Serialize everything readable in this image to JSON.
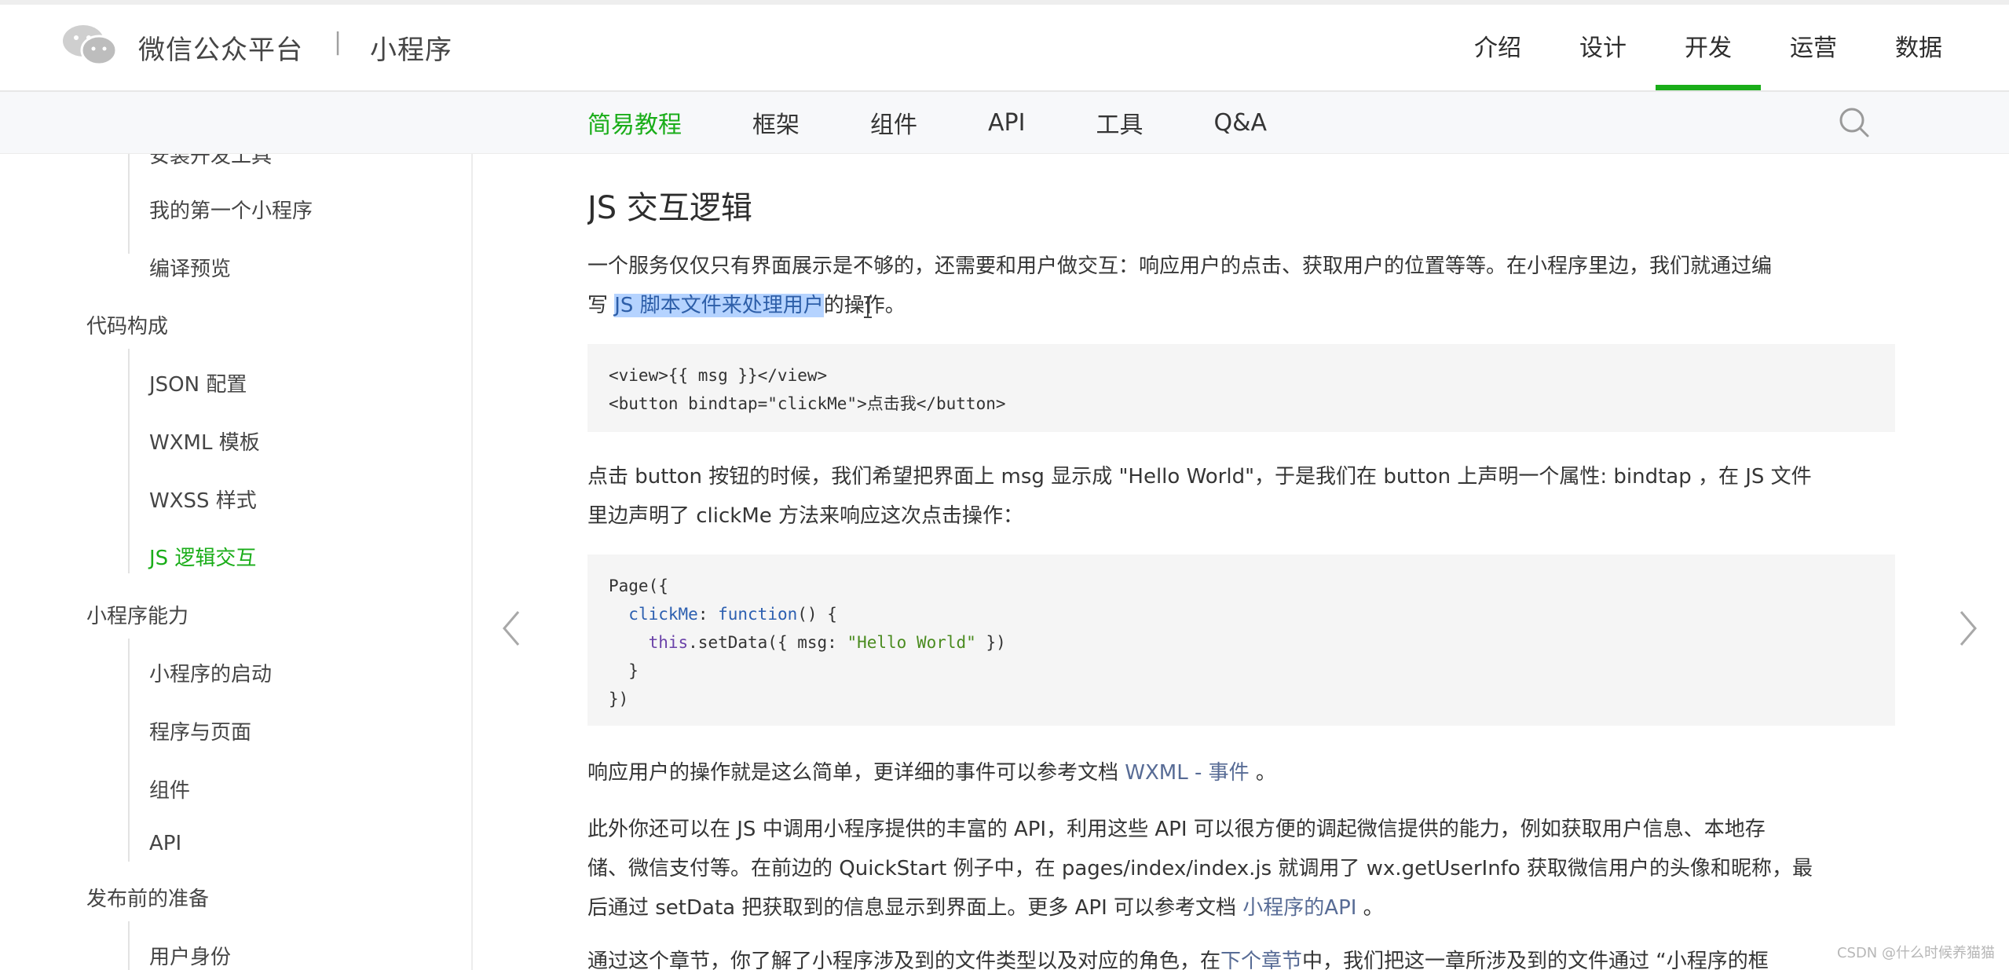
{
  "header": {
    "brand": "微信公众平台",
    "separator": "|",
    "sub_brand": "小程序",
    "nav": [
      {
        "label": "介绍"
      },
      {
        "label": "设计"
      },
      {
        "label": "开发",
        "active": true
      },
      {
        "label": "运营"
      },
      {
        "label": "数据"
      }
    ]
  },
  "subnav": {
    "items": [
      {
        "label": "简易教程",
        "active": true
      },
      {
        "label": "框架"
      },
      {
        "label": "组件"
      },
      {
        "label": "API"
      },
      {
        "label": "工具"
      },
      {
        "label": "Q&A"
      }
    ],
    "search_icon": "search-icon"
  },
  "sidebar": {
    "partial_top": "安装开发工具",
    "items": [
      {
        "label": "我的第一个小程序"
      },
      {
        "label": "编译预览"
      }
    ],
    "groups": [
      {
        "label": "代码构成",
        "items": [
          "JSON 配置",
          "WXML 模板",
          "WXSS 样式",
          "JS 逻辑交互"
        ]
      },
      {
        "label": "小程序能力",
        "items": [
          "小程序的启动",
          "程序与页面",
          "组件",
          "API"
        ]
      },
      {
        "label": "发布前的准备",
        "items": [
          "用户身份"
        ]
      }
    ],
    "active_item": "JS 逻辑交互"
  },
  "content": {
    "title": "JS 交互逻辑",
    "p1_a": "一个服务仅仅只有界面展示是不够的，还需要和用户做交互：响应用户的点击、获取用户的位置等等。在小程序里边，我们就通过编",
    "p1_b_pre": "写 ",
    "p1_b_hl": "JS 脚本文件来处理用户",
    "p1_b_post": "的操作。",
    "code1_line1": "<view>{{ msg }}</view>",
    "code1_line2": "<button bindtap=\"clickMe\">点击我</button>",
    "p2_a": "点击 button 按钮的时候，我们希望把界面上 msg 显示成 \"Hello World\"，于是我们在 button 上声明一个属性: bindtap ，在 JS 文件",
    "p2_b": "里边声明了 clickMe 方法来响应这次点击操作：",
    "code2": {
      "l1": "Page({",
      "l2_prop": "clickMe",
      "l2_colon": ": ",
      "l2_fn": "function",
      "l2_rest": "() {",
      "l3_this": "this",
      "l3_mid": ".setData({ msg: ",
      "l3_str": "\"Hello World\"",
      "l3_end": " })",
      "l4": "}",
      "l5": "})"
    },
    "p3_pre": "响应用户的操作就是这么简单，更详细的事件可以参考文档 ",
    "p3_link": "WXML - 事件",
    "p3_post": " 。",
    "p4_a": "此外你还可以在 JS 中调用小程序提供的丰富的 API，利用这些 API 可以很方便的调起微信提供的能力，例如获取用户信息、本地存",
    "p4_b": "储、微信支付等。在前边的 QuickStart 例子中，在 pages/index/index.js 就调用了 wx.getUserInfo 获取微信用户的头像和昵称，最",
    "p4_c_pre": "后通过 setData 把获取到的信息显示到界面上。更多 API 可以参考文档 ",
    "p4_c_link": "小程序的API",
    "p4_c_post": " 。",
    "p5_pre": "通过这个章节，你了解了小程序涉及到的文件类型以及对应的角色，在",
    "p5_link": "下个章节",
    "p5_post": "中，我们把这一章所涉及到的文件通过 “小程序的框"
  },
  "watermark": "CSDN @什么时候养猫猫",
  "icons": {
    "prev": "chevron-left-icon",
    "next": "chevron-right-icon",
    "logo": "wechat-logo-icon"
  }
}
